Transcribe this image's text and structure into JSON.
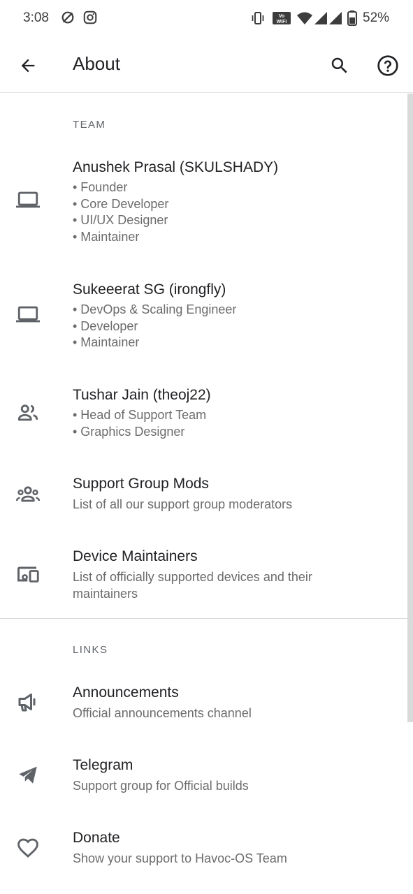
{
  "status_bar": {
    "time": "3:08",
    "battery": "52%",
    "icons": [
      "dnd-off-icon",
      "instagram-icon",
      "vibrate-icon",
      "vowifi-icon",
      "wifi-icon",
      "signal-icon",
      "battery-icon"
    ]
  },
  "app_bar": {
    "title": "About",
    "back_icon": "arrow-back-icon",
    "search_icon": "search-icon",
    "help_icon": "help-icon"
  },
  "sections": {
    "team": {
      "header": "TEAM",
      "items": [
        {
          "icon": "laptop-icon",
          "title": "Anushek Prasal (SKULSHADY)",
          "lines": [
            "• Founder",
            "• Core Developer",
            "• UI/UX Designer",
            "• Maintainer"
          ]
        },
        {
          "icon": "laptop-icon",
          "title": "Sukeeerat SG (irongfly)",
          "lines": [
            "• DevOps & Scaling Engineer",
            "• Developer",
            "• Maintainer"
          ]
        },
        {
          "icon": "people-icon",
          "title": "Tushar Jain (theoj22)",
          "lines": [
            "• Head of Support Team",
            "• Graphics Designer"
          ]
        },
        {
          "icon": "groups-icon",
          "title": "Support Group Mods",
          "subtitle": "List of all our support group moderators"
        },
        {
          "icon": "devices-icon",
          "title": "Device Maintainers",
          "subtitle": "List of officially supported devices and their maintainers"
        }
      ]
    },
    "links": {
      "header": "LINKS",
      "items": [
        {
          "icon": "megaphone-icon",
          "title": "Announcements",
          "subtitle": "Official announcements channel"
        },
        {
          "icon": "send-icon",
          "title": "Telegram",
          "subtitle": "Support group for Official builds"
        },
        {
          "icon": "heart-icon",
          "title": "Donate",
          "subtitle": "Show your support to Havoc-OS Team"
        }
      ]
    }
  },
  "colors": {
    "background": "#ffffff",
    "title_text": "#202124",
    "secondary_text": "#6b6b6b",
    "icon": "#5f6368"
  }
}
